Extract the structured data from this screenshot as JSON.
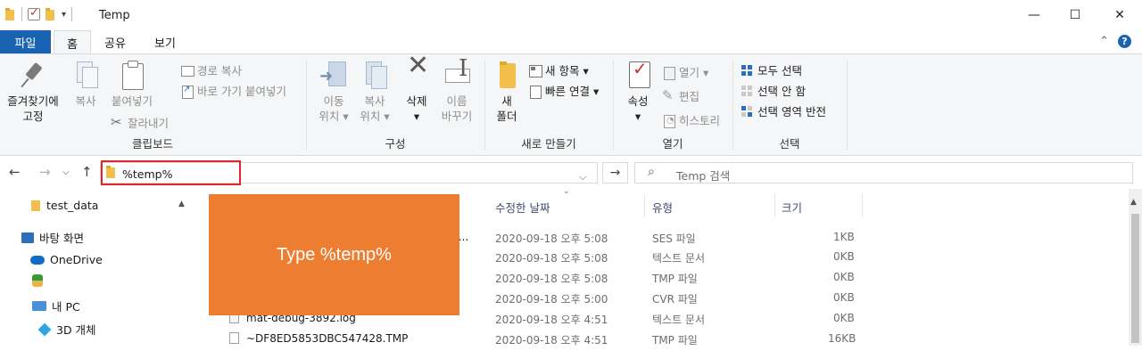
{
  "window": {
    "title": "Temp",
    "controls": {
      "minimize": "—",
      "maximize": "☐",
      "close": "✕"
    }
  },
  "quick_access": {
    "dropdown": "▾"
  },
  "ribbon_tabs": {
    "file": "파일",
    "home": "홈",
    "share": "공유",
    "view": "보기",
    "collapse": "⌃",
    "help": "?"
  },
  "clipboard": {
    "pin_line1": "즐겨찾기에",
    "pin_line2": "고정",
    "copy": "복사",
    "paste": "붙여넣기",
    "copy_path": "경로 복사",
    "paste_shortcut": "바로 가기 붙여넣기",
    "cut": "잘라내기",
    "label": "클립보드"
  },
  "organize": {
    "move_line1": "이동",
    "move_line2": "위치 ▾",
    "copyto_line1": "복사",
    "copyto_line2": "위치 ▾",
    "delete_line1": "삭제",
    "delete_line2": "▾",
    "rename_line1": "이름",
    "rename_line2": "바꾸기",
    "label": "구성"
  },
  "new": {
    "folder_line1": "새",
    "folder_line2": "폴더",
    "new_item": "새 항목 ▾",
    "easy_access": "빠른 연결 ▾",
    "label": "새로 만들기"
  },
  "open": {
    "props_line1": "속성",
    "props_line2": "▾",
    "open": "열기 ▾",
    "edit": "편집",
    "history": "히스토리",
    "label": "열기"
  },
  "select": {
    "select_all": "모두 선택",
    "select_none": "선택 안 함",
    "invert": "선택 영역 반전",
    "label": "선택"
  },
  "navigation": {
    "back": "←",
    "forward": "→",
    "dropdown": "⌵",
    "up": "↑",
    "address_value": "%temp%",
    "address_dropdown": "⌵",
    "go": "→",
    "search_placeholder": "Temp 검색",
    "search_icon": "⌕"
  },
  "nav_pane": {
    "scroll_up": "▲",
    "items": [
      {
        "label": "test_data",
        "icon": "folder-icon"
      },
      {
        "label": "바탕 화면",
        "icon": "desktop-icon"
      },
      {
        "label": "OneDrive",
        "icon": "onedrive-icon"
      },
      {
        "label": "",
        "icon": "user-icon"
      },
      {
        "label": "내 PC",
        "icon": "pc-icon"
      },
      {
        "label": "3D 개체",
        "icon": "3d-objects-icon"
      }
    ]
  },
  "file_list": {
    "sort_caret": "⌄",
    "columns": {
      "name": "",
      "modified": "수정한 날짜",
      "type": "유형",
      "size": "크기"
    },
    "rows": [
      {
        "name": "b.s...",
        "modified": "2020-09-18 오후 5:08",
        "type": "SES 파일",
        "size": "1KB"
      },
      {
        "name": "",
        "modified": "2020-09-18 오후 5:08",
        "type": "텍스트 문서",
        "size": "0KB"
      },
      {
        "name": "",
        "modified": "2020-09-18 오후 5:08",
        "type": "TMP 파일",
        "size": "0KB"
      },
      {
        "name": "",
        "modified": "2020-09-18 오후 5:00",
        "type": "CVR 파일",
        "size": "0KB"
      },
      {
        "name": "mat-debug-3892.log",
        "modified": "2020-09-18 오후 4:51",
        "type": "텍스트 문서",
        "size": "0KB"
      },
      {
        "name": "~DF8ED5853DBC547428.TMP",
        "modified": "2020-09-18 오후 4:51",
        "type": "TMP 파일",
        "size": "16KB"
      }
    ]
  },
  "callout": {
    "text": "Type %temp%",
    "color": "#ec7d31"
  },
  "colors": {
    "file_tab": "#1a63b3",
    "highlight_border": "#e0262c",
    "ribbon_bg": "#f5f6f7"
  }
}
